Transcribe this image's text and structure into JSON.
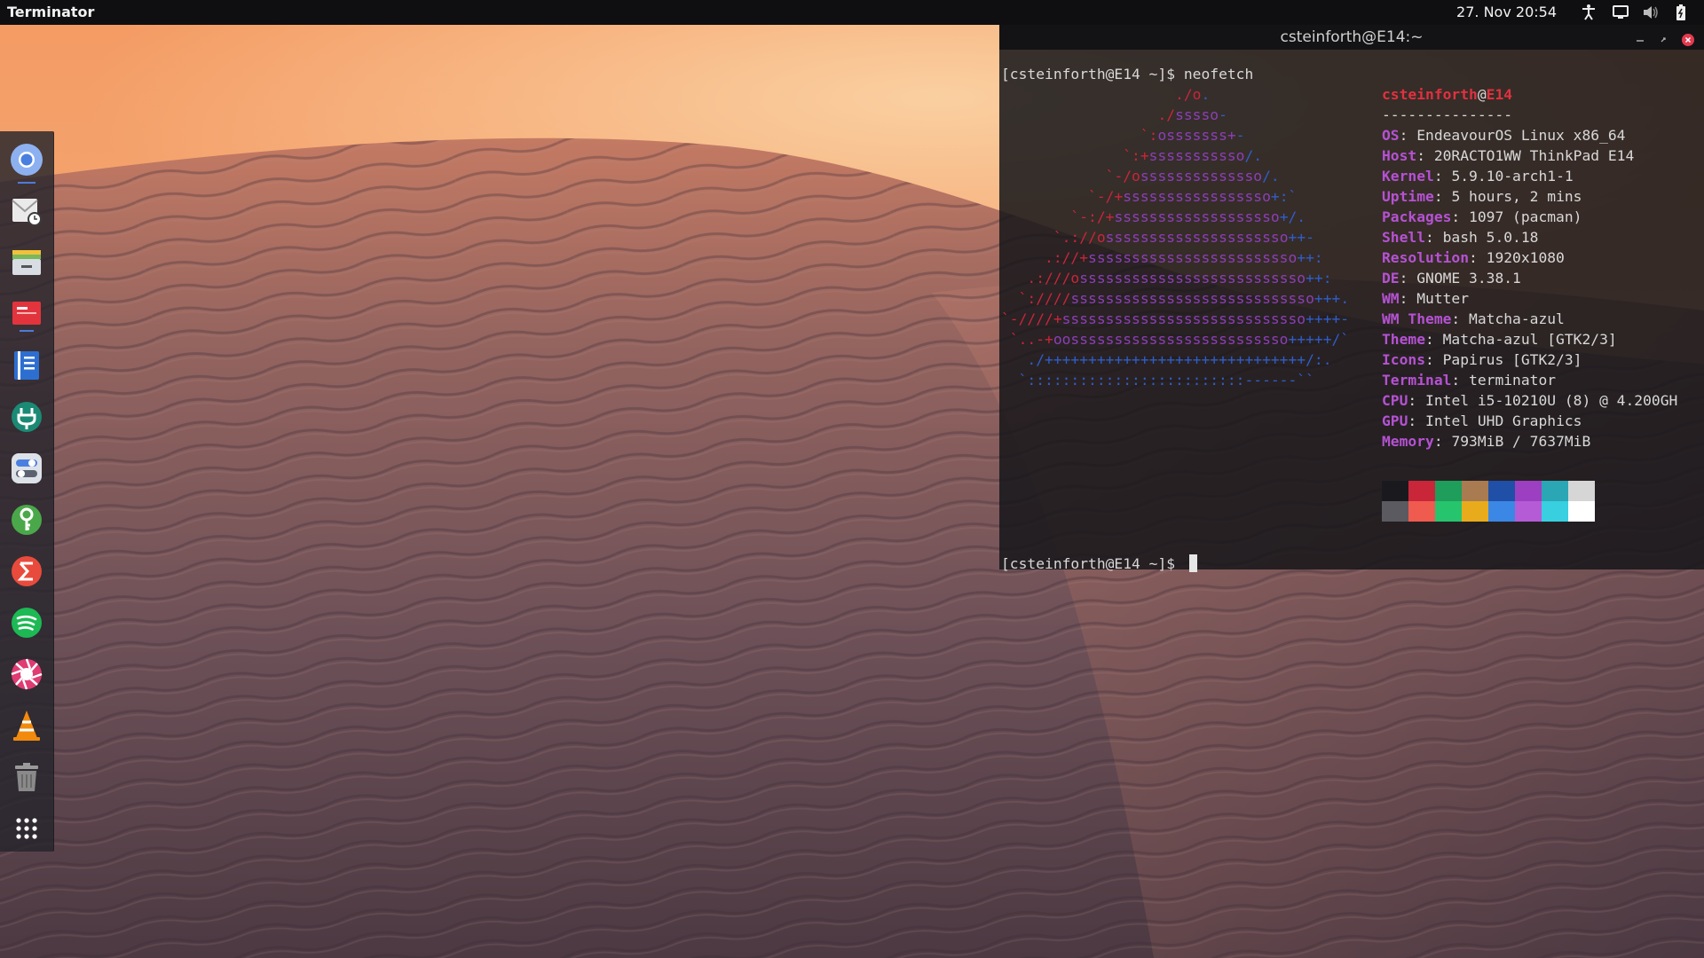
{
  "topbar": {
    "app_menu": "Terminator",
    "clock": "27. Nov  20:54",
    "icons": [
      "accessibility-icon",
      "screen-icon",
      "volume-icon",
      "battery-icon"
    ]
  },
  "dock": {
    "items": [
      {
        "name": "chromium",
        "icon": "chromium-icon",
        "color": "#4a7fe0"
      },
      {
        "name": "mail",
        "icon": "mail-clock-icon",
        "color": "#e9e9e9"
      },
      {
        "name": "files",
        "icon": "file-manager-icon",
        "color": "#7ab85b"
      },
      {
        "name": "presentation",
        "icon": "presentation-icon",
        "color": "#e2343d"
      },
      {
        "name": "notes",
        "icon": "notes-icon",
        "color": "#2d6fd1"
      },
      {
        "name": "network",
        "icon": "network-plug-icon",
        "color": "#1b8a74"
      },
      {
        "name": "settings",
        "icon": "toggle-settings-icon",
        "color": "#c8ccd4"
      },
      {
        "name": "keyring",
        "icon": "key-icon",
        "color": "#4aa84a"
      },
      {
        "name": "sublime",
        "icon": "sigma-icon",
        "color": "#e84b3c"
      },
      {
        "name": "spotify",
        "icon": "spotify-icon",
        "color": "#1db954"
      },
      {
        "name": "shotwell",
        "icon": "aperture-icon",
        "color": "#e03b72"
      },
      {
        "name": "vlc",
        "icon": "vlc-cone-icon",
        "color": "#f28a0d"
      },
      {
        "name": "trash",
        "icon": "trash-icon",
        "color": "#9a9a9a"
      },
      {
        "name": "apps",
        "icon": "app-grid-icon",
        "color": "#ffffff"
      }
    ]
  },
  "terminal": {
    "title": "csteinforth@E14:~",
    "prompt": "[csteinforth@E14 ~]$ ",
    "command": "neofetch",
    "user": "csteinforth",
    "at": "@",
    "host": "E14",
    "separator": "---------------",
    "info": [
      {
        "key": "OS",
        "value": "EndeavourOS Linux x86_64"
      },
      {
        "key": "Host",
        "value": "20RACTO1WW ThinkPad E14"
      },
      {
        "key": "Kernel",
        "value": "5.9.10-arch1-1"
      },
      {
        "key": "Uptime",
        "value": "5 hours, 2 mins"
      },
      {
        "key": "Packages",
        "value": "1097 (pacman)"
      },
      {
        "key": "Shell",
        "value": "bash 5.0.18"
      },
      {
        "key": "Resolution",
        "value": "1920x1080"
      },
      {
        "key": "DE",
        "value": "GNOME 3.38.1"
      },
      {
        "key": "WM",
        "value": "Mutter"
      },
      {
        "key": "WM Theme",
        "value": "Matcha-azul"
      },
      {
        "key": "Theme",
        "value": "Matcha-azul [GTK2/3]"
      },
      {
        "key": "Icons",
        "value": "Papirus [GTK2/3]"
      },
      {
        "key": "Terminal",
        "value": "terminator"
      },
      {
        "key": "CPU",
        "value": "Intel i5-10210U (8) @ 4.200GH"
      },
      {
        "key": "GPU",
        "value": "Intel UHD Graphics"
      },
      {
        "key": "Memory",
        "value": "793MiB / 7637MiB"
      }
    ],
    "logo": [
      {
        "indent": "                    ",
        "red": "./o",
        "purple": "",
        "blue": "."
      },
      {
        "indent": "                  ",
        "red": "./",
        "purple": "sssso",
        "blue": "-"
      },
      {
        "indent": "                ",
        "red": "`:",
        "purple": "osssssss+",
        "blue": "-"
      },
      {
        "indent": "              ",
        "red": "`:+",
        "purple": "sssssssssso",
        "blue": "/."
      },
      {
        "indent": "            ",
        "red": "`-/o",
        "purple": "ssssssssssssso",
        "blue": "/."
      },
      {
        "indent": "          ",
        "red": "`-/+",
        "purple": "sssssssssssssssso",
        "blue": "+:`"
      },
      {
        "indent": "        ",
        "red": "`-:/+",
        "purple": "sssssssssssssssssso",
        "blue": "+/."
      },
      {
        "indent": "      ",
        "red": "`.://o",
        "purple": "sssssssssssssssssssso",
        "blue": "++-"
      },
      {
        "indent": "     ",
        "red": ".://+",
        "purple": "ssssssssssssssssssssssso",
        "blue": "++:"
      },
      {
        "indent": "   ",
        "red": ".:///o",
        "purple": "ssssssssssssssssssssssssso",
        "blue": "++:"
      },
      {
        "indent": "  ",
        "red": "`:////",
        "purple": "ssssssssssssssssssssssssssso",
        "blue": "+++."
      },
      {
        "indent": "",
        "red": "`-////+",
        "purple": "ssssssssssssssssssssssssssso",
        "blue": "++++-"
      },
      {
        "indent": " ",
        "red": "`..-+",
        "purple": "oosssssssssssssssssssssssso",
        "blue": "+++++/`"
      },
      {
        "indent": "   ",
        "red": "",
        "purple": "",
        "blue": "./++++++++++++++++++++++++++++++/:."
      },
      {
        "indent": "  ",
        "red": "",
        "purple": "",
        "blue": "`:::::::::::::::::::::::::------``"
      }
    ],
    "palette_top": [
      "#1a1a1e",
      "#c9263a",
      "#1e9e5a",
      "#a97b50",
      "#1f4fa6",
      "#9c3fc0",
      "#2aa6b4",
      "#d6d6d6"
    ],
    "palette_bottom": [
      "#5a5a60",
      "#ef5b4f",
      "#27c46e",
      "#e8ab1c",
      "#3b87e6",
      "#b55bd6",
      "#38cfe0",
      "#ffffff"
    ]
  }
}
